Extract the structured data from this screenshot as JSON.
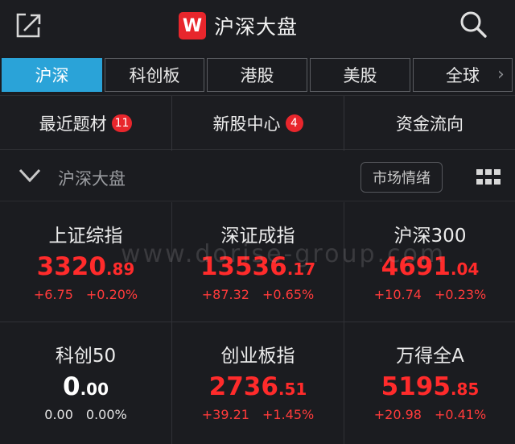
{
  "header": {
    "title": "沪深大盘",
    "logo_letter": "W",
    "icons": {
      "share": "share-icon",
      "search": "search-icon"
    }
  },
  "tabs": [
    {
      "label": "沪深",
      "active": true
    },
    {
      "label": "科创板",
      "active": false
    },
    {
      "label": "港股",
      "active": false
    },
    {
      "label": "美股",
      "active": false
    },
    {
      "label": "全球",
      "active": false
    }
  ],
  "quick_links": [
    {
      "label": "最近题材",
      "badge": "11"
    },
    {
      "label": "新股中心",
      "badge": "4"
    },
    {
      "label": "资金流向",
      "badge": ""
    }
  ],
  "section": {
    "title": "沪深大盘",
    "mood_button": "市场情绪"
  },
  "watermark": "www.dorise-group.com",
  "indices": [
    {
      "name": "上证综指",
      "int": "3320",
      "dec": ".89",
      "change": "+6.75",
      "pct": "+0.20%",
      "status": "up"
    },
    {
      "name": "深证成指",
      "int": "13536",
      "dec": ".17",
      "change": "+87.32",
      "pct": "+0.65%",
      "status": "up"
    },
    {
      "name": "沪深300",
      "int": "4691",
      "dec": ".04",
      "change": "+10.74",
      "pct": "+0.23%",
      "status": "up"
    },
    {
      "name": "科创50",
      "int": "0",
      "dec": ".00",
      "change": "0.00",
      "pct": "0.00%",
      "status": "flat"
    },
    {
      "name": "创业板指",
      "int": "2736",
      "dec": ".51",
      "change": "+39.21",
      "pct": "+1.45%",
      "status": "up"
    },
    {
      "name": "万得全A",
      "int": "5195",
      "dec": ".85",
      "change": "+20.98",
      "pct": "+0.41%",
      "status": "up"
    }
  ],
  "colors": {
    "up": "#ff2b2b",
    "accent_tab": "#2aa3d8",
    "logo": "#e8262c",
    "background": "#1b1c20"
  }
}
